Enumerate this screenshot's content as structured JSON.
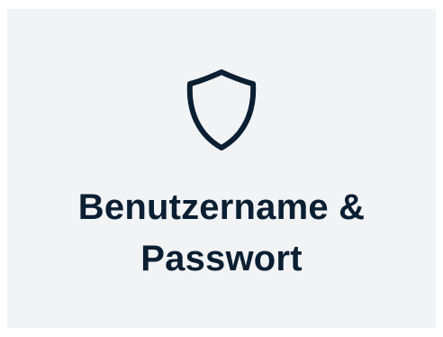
{
  "card": {
    "icon": "shield-icon",
    "title": "Benutzername & Passwort",
    "icon_color": "#0b1f33",
    "background_color": "#f2f3f5"
  }
}
